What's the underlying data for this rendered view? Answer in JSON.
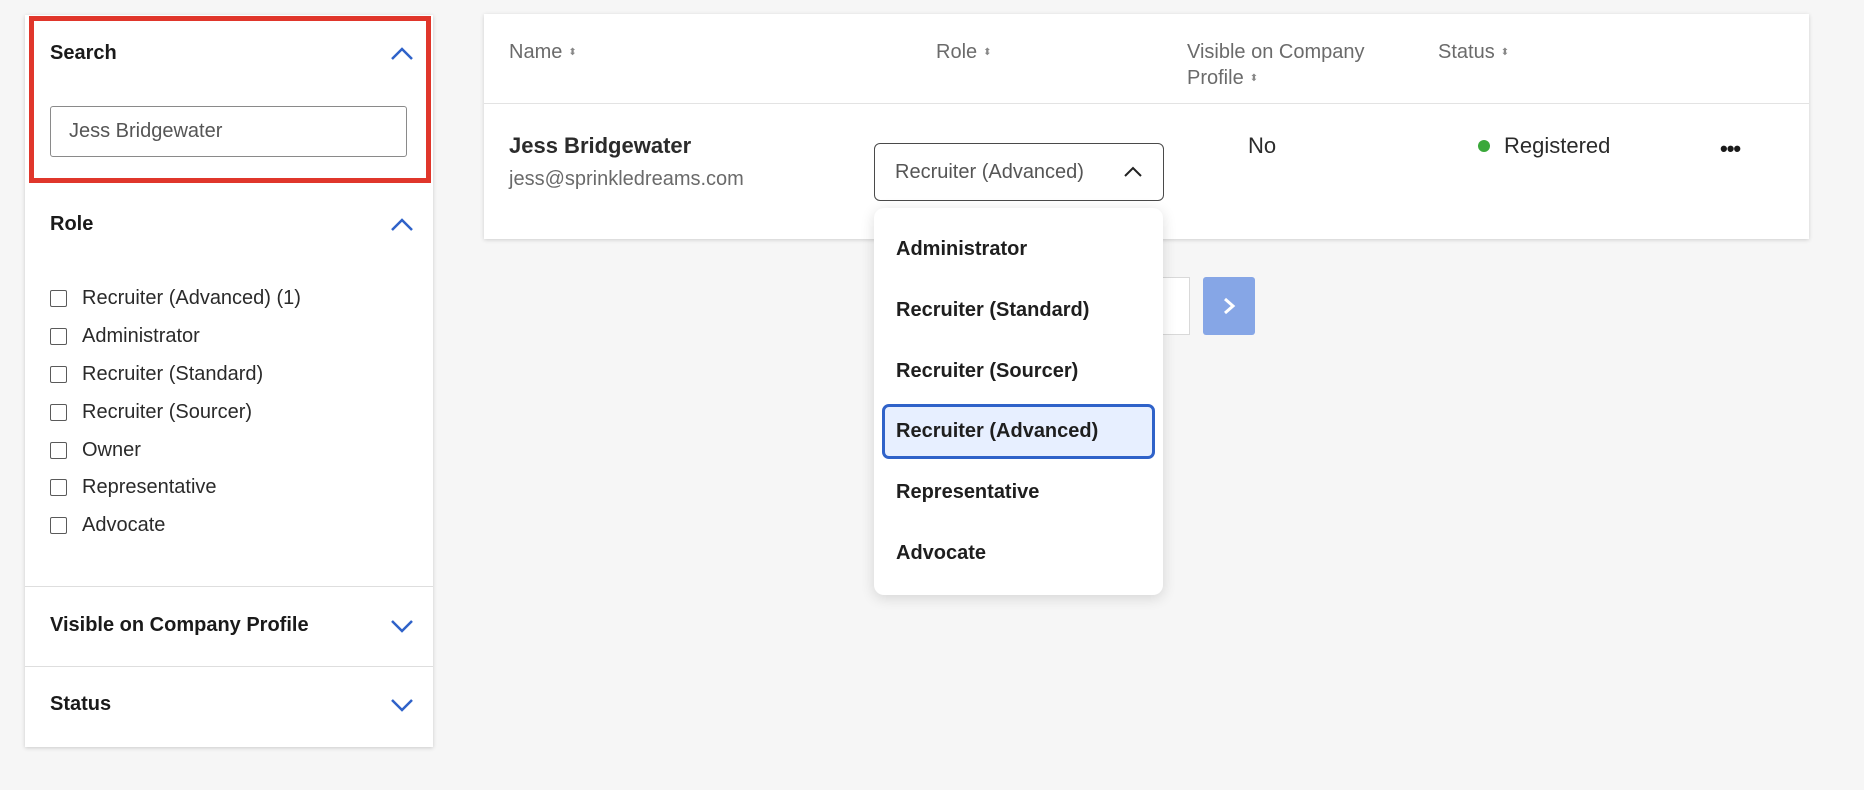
{
  "sidebar": {
    "search": {
      "title": "Search",
      "value": "Jess Bridgewater"
    },
    "role": {
      "title": "Role",
      "options": [
        "Recruiter (Advanced) (1)",
        "Administrator",
        "Recruiter (Standard)",
        "Recruiter (Sourcer)",
        "Owner",
        "Representative",
        "Advocate"
      ]
    },
    "visible": {
      "title": "Visible on Company Profile"
    },
    "status": {
      "title": "Status"
    }
  },
  "table": {
    "headers": {
      "name": "Name",
      "role": "Role",
      "visible_line1": "Visible on Company",
      "visible_line2": "Profile",
      "status": "Status"
    },
    "rows": [
      {
        "name": "Jess Bridgewater",
        "email": "jess@sprinkledreams.com",
        "role": "Recruiter (Advanced)",
        "visible": "No",
        "status": "Registered"
      }
    ]
  },
  "role_dropdown": {
    "options": [
      "Administrator",
      "Recruiter (Standard)",
      "Recruiter (Sourcer)",
      "Recruiter (Advanced)",
      "Representative",
      "Advocate"
    ],
    "selected": "Recruiter (Advanced)"
  },
  "colors": {
    "accent": "#2f62c9",
    "highlight": "#e0362b",
    "status_registered": "#3aa83a",
    "next_button": "#86a6e6"
  }
}
